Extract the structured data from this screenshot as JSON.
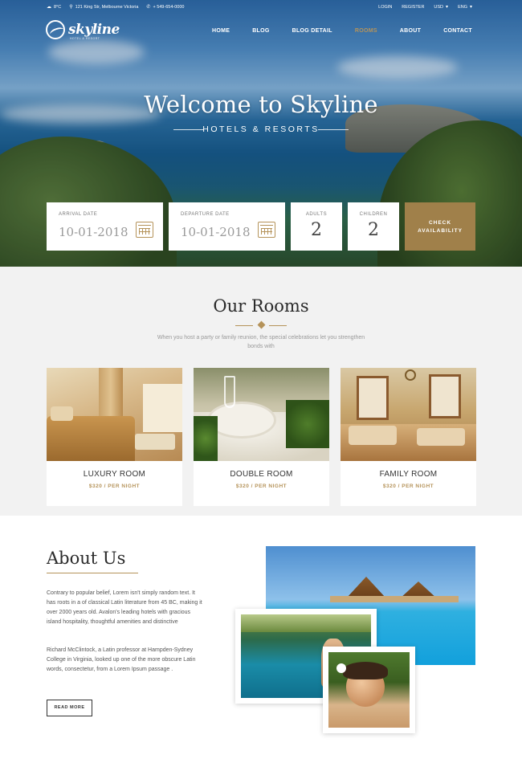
{
  "topbar": {
    "weather": "8°C",
    "address": "121 King Str, Melbourne Victoria",
    "phone": "+ 549-654-0000",
    "login": "LOGIN",
    "register": "REGISTER",
    "currency": "USD",
    "language": "ENG"
  },
  "logo": {
    "text": "skyline",
    "tagline": "HOTEL & RESORT"
  },
  "nav": {
    "items": [
      {
        "label": "HOME"
      },
      {
        "label": "BLOG"
      },
      {
        "label": "BLOG DETAIL"
      },
      {
        "label": "ROOMS"
      },
      {
        "label": "ABOUT"
      },
      {
        "label": "CONTACT"
      }
    ],
    "active": "ROOMS"
  },
  "hero": {
    "title": "Welcome to Skyline",
    "subtitle": "HOTELS & RESORTS"
  },
  "booking": {
    "arrival_label": "ARRIVAL DATE",
    "arrival_value": "10-01-2018",
    "departure_label": "DEPARTURE DATE",
    "departure_value": "10-01-2018",
    "adults_label": "ADULTS",
    "adults_value": "2",
    "children_label": "CHILDREN",
    "children_value": "2",
    "button_line1": "CHECK",
    "button_line2": "AVAILABILITY"
  },
  "rooms": {
    "title": "Our Rooms",
    "description": "When you host a party or family reunion, the special celebrations let you strengthen bonds with",
    "items": [
      {
        "name": "LUXURY ROOM",
        "price": "$320 / PER NIGHT"
      },
      {
        "name": "DOUBLE ROOM",
        "price": "$320 / PER NIGHT"
      },
      {
        "name": "FAMILY ROOM",
        "price": "$320 / PER NIGHT"
      }
    ]
  },
  "about": {
    "title": "About Us",
    "paragraph1": "Contrary to popular belief, Lorem isn't simply random text. It has roots in a of classical Latin literature from 45 BC, making it over 2000 years old. Avalon's leading hotels with gracious island hospitality, thoughtful amenities and distinctive",
    "paragraph2": "Richard McClintock, a Latin professor at Hampden-Sydney College in Virginia, looked up one of the more obscure Latin words, consectetur, from a Lorem Ipsum passage .",
    "button": "READ MORE"
  },
  "colors": {
    "accent": "#b5935a",
    "button_bg": "#a0804a",
    "section_bg": "#f2f2f2"
  },
  "icons": [
    "cloud-icon",
    "location-pin-icon",
    "phone-icon",
    "calendar-icon",
    "ornament-icon",
    "chevron-down-icon"
  ]
}
